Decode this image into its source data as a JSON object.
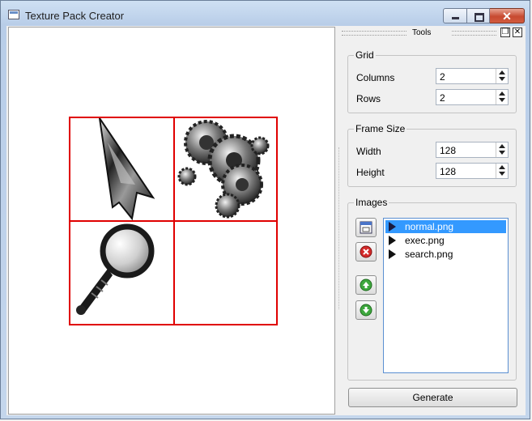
{
  "window": {
    "title": "Texture Pack Creator"
  },
  "dock": {
    "title": "Tools"
  },
  "grid_group": {
    "title": "Grid",
    "columns_label": "Columns",
    "columns_value": "2",
    "rows_label": "Rows",
    "rows_value": "2"
  },
  "frame_group": {
    "title": "Frame Size",
    "width_label": "Width",
    "width_value": "128",
    "height_label": "Height",
    "height_value": "128"
  },
  "images_group": {
    "title": "Images",
    "items": [
      "normal.png",
      "exec.png",
      "search.png"
    ],
    "selected": "normal.png"
  },
  "generate_label": "Generate",
  "colors": {
    "grid_lines": "#e00000",
    "selection": "#3399ff"
  },
  "canvas_cells": [
    "cursor-arrow-image",
    "gears-image",
    "magnifier-image",
    "empty"
  ]
}
